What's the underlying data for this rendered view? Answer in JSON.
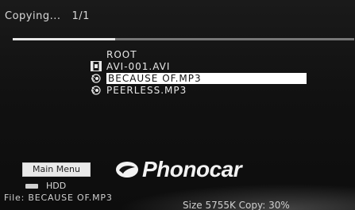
{
  "status": {
    "label": "Copying...",
    "counter": "1/1"
  },
  "progress": {
    "fraction": 0.3
  },
  "file_list": {
    "root": "ROOT",
    "items": [
      {
        "icon": "video-file-icon",
        "name": "AVI-001.AVI",
        "selected": false
      },
      {
        "icon": "audio-file-icon",
        "name": "BECAUSE OF.MP3",
        "selected": true
      },
      {
        "icon": "audio-file-icon",
        "name": "PEERLESS.MP3",
        "selected": false
      }
    ]
  },
  "main_menu_label": "Main Menu",
  "logo_text": "Phonocar",
  "device": {
    "icon": "hdd-icon",
    "label": "HDD"
  },
  "footer": {
    "file_text": "File: BECAUSE OF.MP3",
    "size_copy_text": "Size 5755K Copy: 30%"
  },
  "colors": {
    "background": "#111111",
    "text": "#e8e8e8",
    "highlight": "#ffffff"
  }
}
